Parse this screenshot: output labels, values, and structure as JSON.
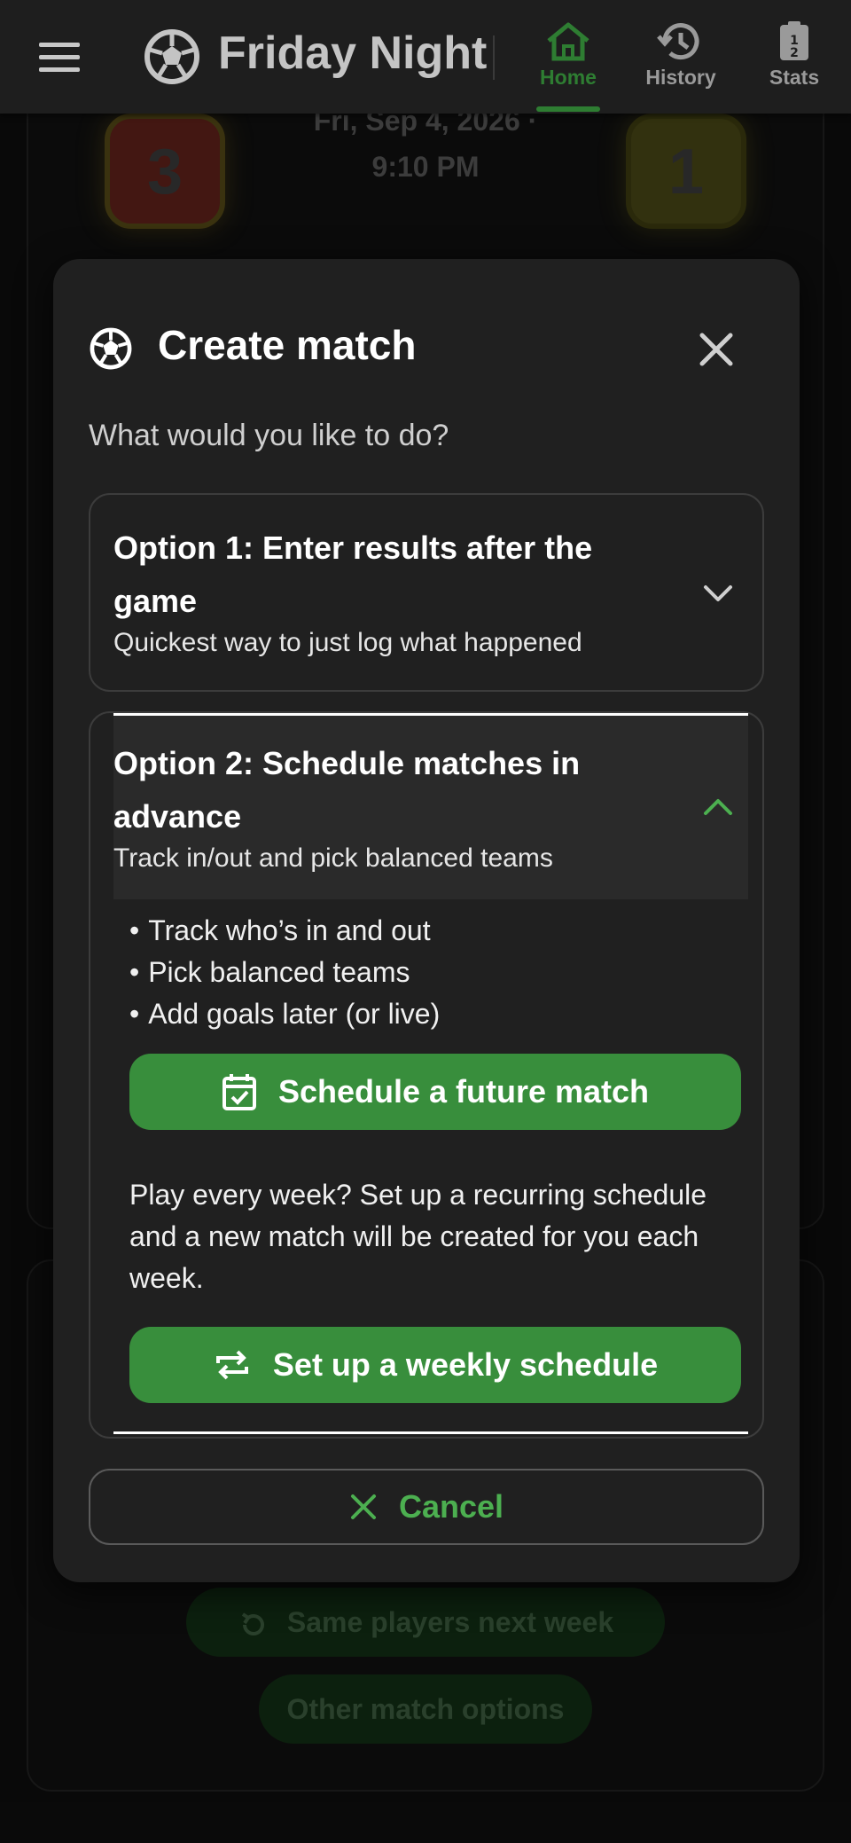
{
  "appbar": {
    "title": "Friday Night",
    "tabs": [
      {
        "label": "Home",
        "icon": "home-icon",
        "active": true
      },
      {
        "label": "History",
        "icon": "history-icon",
        "active": false
      },
      {
        "label": "Stats",
        "icon": "stats-icon",
        "active": false
      }
    ]
  },
  "background": {
    "score_left": "3",
    "score_right": "1",
    "date_line1": "Fri, Sep 4, 2026 ·",
    "date_line2": "9:10 PM",
    "same_players_label": "Same players next week",
    "other_options_label": "Other match options"
  },
  "dialog": {
    "title": "Create match",
    "question": "What would you like to do?",
    "option1": {
      "title": "Option 1: Enter results after the game",
      "subtitle": "Quickest way to just log what happened",
      "expanded": false
    },
    "option2": {
      "title": "Option 2: Schedule matches in advance",
      "subtitle": "Track in/out and pick balanced teams",
      "expanded": true,
      "bullets": [
        "Track who’s in and out",
        "Pick balanced teams",
        "Add goals later (or live)"
      ],
      "schedule_button": "Schedule a future match",
      "weekly_text": "Play every week? Set up a recurring schedule and a new match will be created for you each week.",
      "weekly_button": "Set up a weekly schedule"
    },
    "cancel_label": "Cancel"
  },
  "colors": {
    "accent_green": "#388e3c",
    "active_tab": "#2e7d32",
    "dialog_bg": "#202020",
    "page_bg": "#121212"
  }
}
